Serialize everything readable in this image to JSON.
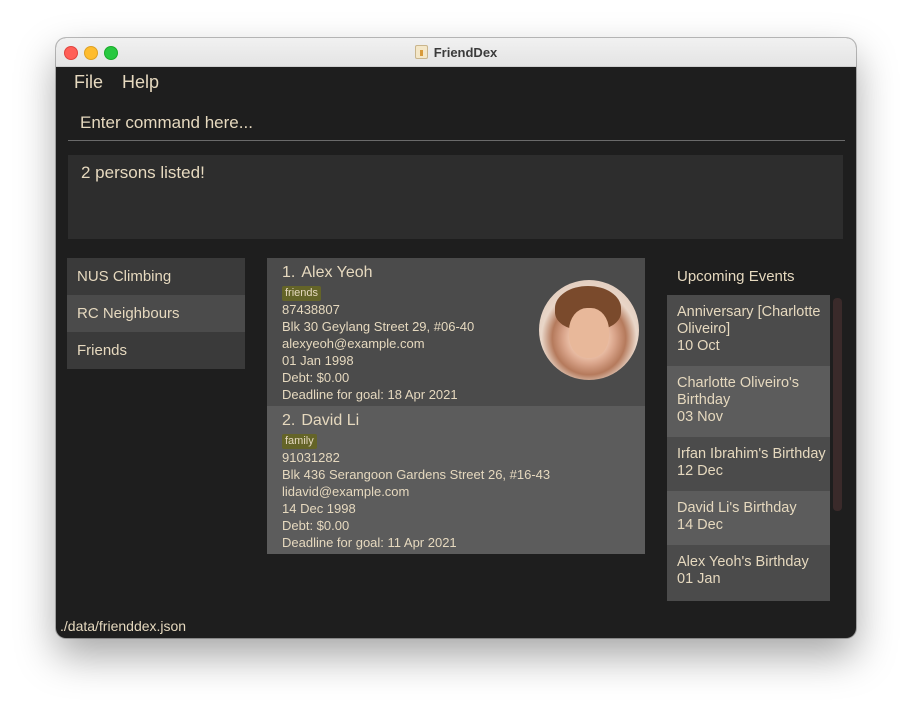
{
  "window": {
    "title": "FriendDex",
    "app_icon": "java-app-icon"
  },
  "menu": {
    "file": "File",
    "help": "Help"
  },
  "command": {
    "placeholder": "Enter command here..."
  },
  "result": {
    "text": "2 persons listed!"
  },
  "groups": [
    {
      "label": "NUS Climbing"
    },
    {
      "label": "RC Neighbours"
    },
    {
      "label": "Friends"
    }
  ],
  "persons": [
    {
      "index": "1.",
      "name": "Alex Yeoh",
      "tag": "friends",
      "phone": "87438807",
      "address": "Blk 30 Geylang Street 29, #06-40",
      "email": "alexyeoh@example.com",
      "birthday": "01 Jan 1998",
      "debt": "Debt: $0.00",
      "deadline": "Deadline for goal: 18 Apr 2021",
      "has_photo": true
    },
    {
      "index": "2.",
      "name": "David Li",
      "tag": "family",
      "phone": "91031282",
      "address": "Blk 436 Serangoon Gardens Street 26, #16-43",
      "email": "lidavid@example.com",
      "birthday": "14 Dec 1998",
      "debt": "Debt: $0.00",
      "deadline": "Deadline for goal: 11 Apr 2021",
      "has_photo": false
    }
  ],
  "events": {
    "header": "Upcoming Events",
    "items": [
      {
        "title": "Anniversary [Charlotte Oliveiro]",
        "date": "10 Oct"
      },
      {
        "title": "Charlotte Oliveiro's Birthday",
        "date": "03 Nov"
      },
      {
        "title": "Irfan Ibrahim's Birthday",
        "date": "12 Dec"
      },
      {
        "title": "David Li's Birthday",
        "date": "14 Dec"
      },
      {
        "title": "Alex Yeoh's Birthday",
        "date": "01 Jan"
      }
    ]
  },
  "status": {
    "path": "./data/frienddex.json"
  },
  "colors": {
    "background": "#1e1e1e",
    "text": "#e6d9bf",
    "panel_dark": "#4b4b4b",
    "panel_light": "#5c5c5c",
    "tag": "#646428"
  }
}
